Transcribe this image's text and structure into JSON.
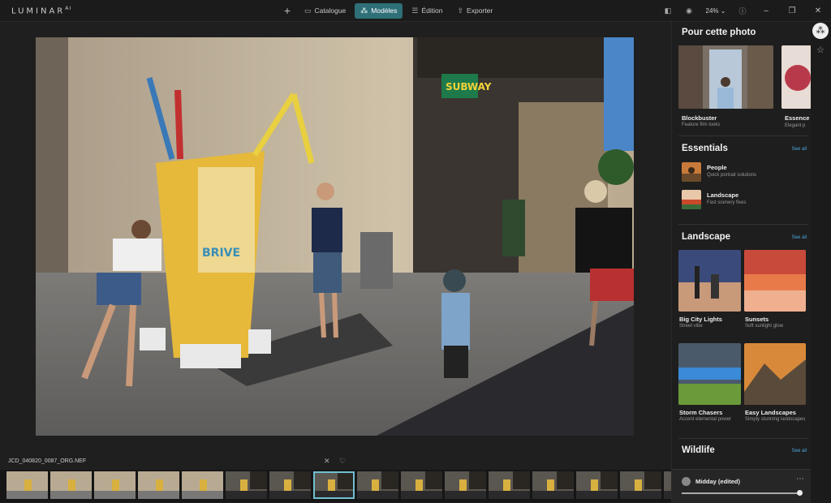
{
  "app": {
    "logo": "LUMINAR",
    "logo_sup": "AI"
  },
  "nav": {
    "add_label": "+",
    "catalogue": "Catalogue",
    "modeles": "Modèles",
    "edition": "Édition",
    "exporter": "Exporter",
    "active_color": "#2e6f78"
  },
  "toolbar": {
    "zoom": "24%"
  },
  "file": {
    "name": "JCD_040820_0087_ORG.NEF"
  },
  "filmstrip": {
    "count": 16,
    "selected_index": 7
  },
  "panel": {
    "pour_cette_photo": {
      "title": "Pour cette photo",
      "cards": [
        {
          "title": "Blockbuster",
          "sub": "Feature film looks"
        },
        {
          "title": "Essence",
          "sub": "Elegant p"
        }
      ]
    },
    "essentials": {
      "title": "Essentials",
      "see_all": "See all",
      "items": [
        {
          "title": "People",
          "sub": "Quick portrait solutions"
        },
        {
          "title": "Landscape",
          "sub": "Fast scenery fixes"
        }
      ]
    },
    "landscape": {
      "title": "Landscape",
      "see_all": "See all",
      "cards": [
        {
          "title": "Big City Lights",
          "sub": "Street vibe"
        },
        {
          "title": "Sunsets",
          "sub": "Soft sunlight glow"
        },
        {
          "title": "Storm Chasers",
          "sub": "Accent elemental power"
        },
        {
          "title": "Easy Landscapes",
          "sub": "Simply stunning landscapes"
        }
      ]
    },
    "wildlife": {
      "title": "Wildlife",
      "see_all": "See all"
    }
  },
  "bottom": {
    "preset": "Midday (edited)",
    "amount": 1.0
  },
  "accent_link": "#4ea6e0"
}
